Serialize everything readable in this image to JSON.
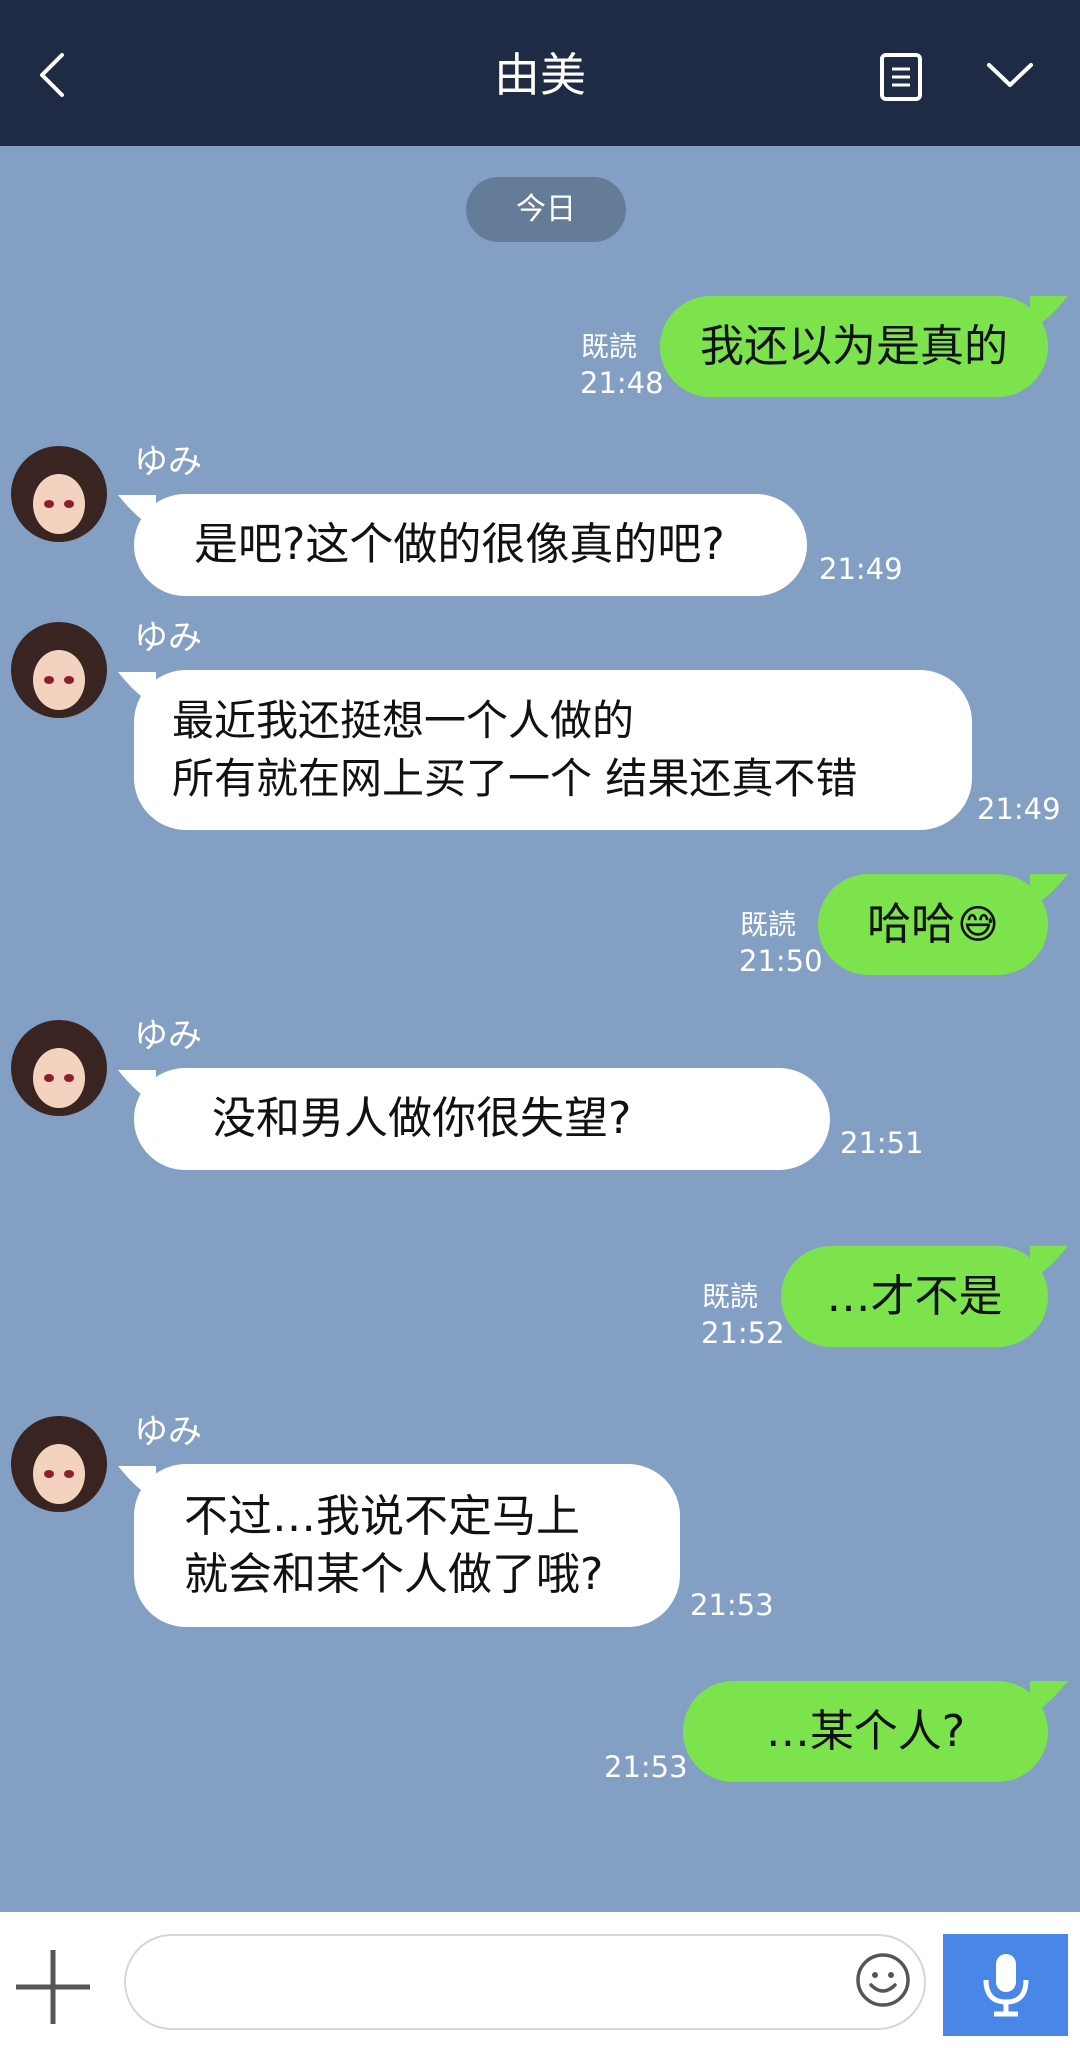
{
  "header": {
    "title": "由美"
  },
  "date_divider": "今日",
  "messages": [
    {
      "side": "out",
      "text": "我还以为是真的",
      "read": "既読",
      "time": "21:48"
    },
    {
      "side": "in",
      "sender": "ゆみ",
      "text": "是吧?这个做的很像真的吧?",
      "time": "21:49"
    },
    {
      "side": "in",
      "sender": "ゆみ",
      "text": "最近我还挺想一个人做的\n所有就在网上买了一个 结果还真不错",
      "time": "21:49"
    },
    {
      "side": "out",
      "text": "哈哈",
      "emoji": "😅",
      "read": "既読",
      "time": "21:50"
    },
    {
      "side": "in",
      "sender": "ゆみ",
      "text": "没和男人做你很失望?",
      "time": "21:51"
    },
    {
      "side": "out",
      "text": "…才不是",
      "read": "既読",
      "time": "21:52"
    },
    {
      "side": "in",
      "sender": "ゆみ",
      "text": "不过…我说不定马上\n就会和某个人做了哦?",
      "time": "21:53"
    },
    {
      "side": "out",
      "text": "…某个人?",
      "time": "21:53"
    }
  ],
  "composer": {
    "placeholder": ""
  },
  "colors": {
    "header": "#1f2a44",
    "background": "#839fc3",
    "incoming": "#ffffff",
    "outgoing": "#7de34d",
    "mic_button": "#4a86e8"
  },
  "icons": [
    "back-arrow-icon",
    "notes-icon",
    "chevron-down-icon",
    "plus-icon",
    "emoji-icon",
    "microphone-icon"
  ]
}
